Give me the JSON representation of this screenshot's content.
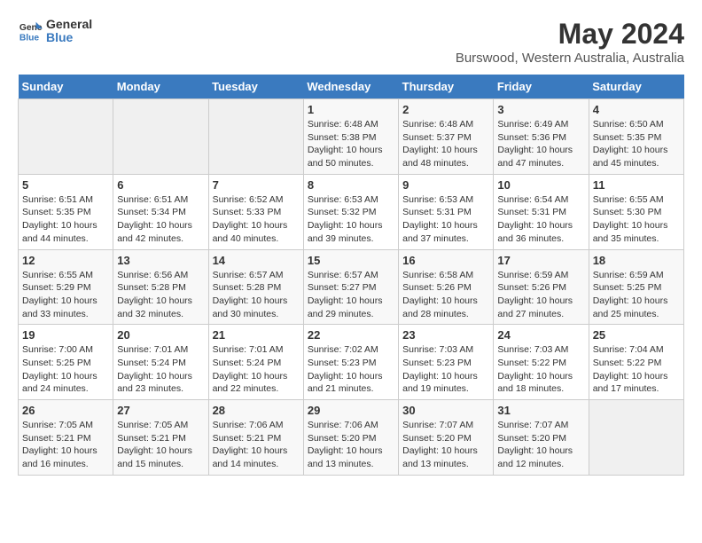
{
  "header": {
    "logo_line1": "General",
    "logo_line2": "Blue",
    "title": "May 2024",
    "subtitle": "Burswood, Western Australia, Australia"
  },
  "days_of_week": [
    "Sunday",
    "Monday",
    "Tuesday",
    "Wednesday",
    "Thursday",
    "Friday",
    "Saturday"
  ],
  "weeks": [
    [
      {
        "num": "",
        "info": ""
      },
      {
        "num": "",
        "info": ""
      },
      {
        "num": "",
        "info": ""
      },
      {
        "num": "1",
        "info": "Sunrise: 6:48 AM\nSunset: 5:38 PM\nDaylight: 10 hours\nand 50 minutes."
      },
      {
        "num": "2",
        "info": "Sunrise: 6:48 AM\nSunset: 5:37 PM\nDaylight: 10 hours\nand 48 minutes."
      },
      {
        "num": "3",
        "info": "Sunrise: 6:49 AM\nSunset: 5:36 PM\nDaylight: 10 hours\nand 47 minutes."
      },
      {
        "num": "4",
        "info": "Sunrise: 6:50 AM\nSunset: 5:35 PM\nDaylight: 10 hours\nand 45 minutes."
      }
    ],
    [
      {
        "num": "5",
        "info": "Sunrise: 6:51 AM\nSunset: 5:35 PM\nDaylight: 10 hours\nand 44 minutes."
      },
      {
        "num": "6",
        "info": "Sunrise: 6:51 AM\nSunset: 5:34 PM\nDaylight: 10 hours\nand 42 minutes."
      },
      {
        "num": "7",
        "info": "Sunrise: 6:52 AM\nSunset: 5:33 PM\nDaylight: 10 hours\nand 40 minutes."
      },
      {
        "num": "8",
        "info": "Sunrise: 6:53 AM\nSunset: 5:32 PM\nDaylight: 10 hours\nand 39 minutes."
      },
      {
        "num": "9",
        "info": "Sunrise: 6:53 AM\nSunset: 5:31 PM\nDaylight: 10 hours\nand 37 minutes."
      },
      {
        "num": "10",
        "info": "Sunrise: 6:54 AM\nSunset: 5:31 PM\nDaylight: 10 hours\nand 36 minutes."
      },
      {
        "num": "11",
        "info": "Sunrise: 6:55 AM\nSunset: 5:30 PM\nDaylight: 10 hours\nand 35 minutes."
      }
    ],
    [
      {
        "num": "12",
        "info": "Sunrise: 6:55 AM\nSunset: 5:29 PM\nDaylight: 10 hours\nand 33 minutes."
      },
      {
        "num": "13",
        "info": "Sunrise: 6:56 AM\nSunset: 5:28 PM\nDaylight: 10 hours\nand 32 minutes."
      },
      {
        "num": "14",
        "info": "Sunrise: 6:57 AM\nSunset: 5:28 PM\nDaylight: 10 hours\nand 30 minutes."
      },
      {
        "num": "15",
        "info": "Sunrise: 6:57 AM\nSunset: 5:27 PM\nDaylight: 10 hours\nand 29 minutes."
      },
      {
        "num": "16",
        "info": "Sunrise: 6:58 AM\nSunset: 5:26 PM\nDaylight: 10 hours\nand 28 minutes."
      },
      {
        "num": "17",
        "info": "Sunrise: 6:59 AM\nSunset: 5:26 PM\nDaylight: 10 hours\nand 27 minutes."
      },
      {
        "num": "18",
        "info": "Sunrise: 6:59 AM\nSunset: 5:25 PM\nDaylight: 10 hours\nand 25 minutes."
      }
    ],
    [
      {
        "num": "19",
        "info": "Sunrise: 7:00 AM\nSunset: 5:25 PM\nDaylight: 10 hours\nand 24 minutes."
      },
      {
        "num": "20",
        "info": "Sunrise: 7:01 AM\nSunset: 5:24 PM\nDaylight: 10 hours\nand 23 minutes."
      },
      {
        "num": "21",
        "info": "Sunrise: 7:01 AM\nSunset: 5:24 PM\nDaylight: 10 hours\nand 22 minutes."
      },
      {
        "num": "22",
        "info": "Sunrise: 7:02 AM\nSunset: 5:23 PM\nDaylight: 10 hours\nand 21 minutes."
      },
      {
        "num": "23",
        "info": "Sunrise: 7:03 AM\nSunset: 5:23 PM\nDaylight: 10 hours\nand 19 minutes."
      },
      {
        "num": "24",
        "info": "Sunrise: 7:03 AM\nSunset: 5:22 PM\nDaylight: 10 hours\nand 18 minutes."
      },
      {
        "num": "25",
        "info": "Sunrise: 7:04 AM\nSunset: 5:22 PM\nDaylight: 10 hours\nand 17 minutes."
      }
    ],
    [
      {
        "num": "26",
        "info": "Sunrise: 7:05 AM\nSunset: 5:21 PM\nDaylight: 10 hours\nand 16 minutes."
      },
      {
        "num": "27",
        "info": "Sunrise: 7:05 AM\nSunset: 5:21 PM\nDaylight: 10 hours\nand 15 minutes."
      },
      {
        "num": "28",
        "info": "Sunrise: 7:06 AM\nSunset: 5:21 PM\nDaylight: 10 hours\nand 14 minutes."
      },
      {
        "num": "29",
        "info": "Sunrise: 7:06 AM\nSunset: 5:20 PM\nDaylight: 10 hours\nand 13 minutes."
      },
      {
        "num": "30",
        "info": "Sunrise: 7:07 AM\nSunset: 5:20 PM\nDaylight: 10 hours\nand 13 minutes."
      },
      {
        "num": "31",
        "info": "Sunrise: 7:07 AM\nSunset: 5:20 PM\nDaylight: 10 hours\nand 12 minutes."
      },
      {
        "num": "",
        "info": ""
      }
    ]
  ]
}
